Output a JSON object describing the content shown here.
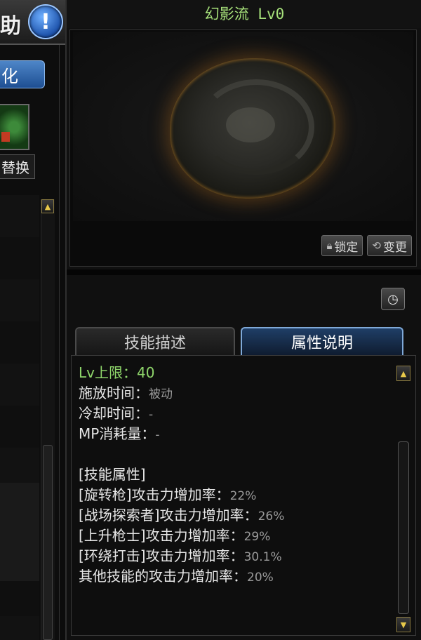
{
  "left_panel": {
    "title_char": "助",
    "help_icon": "!",
    "blue_tab_label": "化",
    "swap_label": "替换"
  },
  "skill": {
    "title": "幻影流 Lv0",
    "lock_label": "锁定",
    "change_label": "变更"
  },
  "tabs": {
    "description": "技能描述",
    "attributes": "属性说明"
  },
  "attributes": {
    "lv_limit_label": "Lv上限：",
    "lv_limit_value": "40",
    "cast_time_label": "施放时间：",
    "cast_time_value": "被动",
    "cooldown_label": "冷却时间：",
    "cooldown_value": "-",
    "mp_label": "MP消耗量：",
    "mp_value": "-",
    "section_header": "[技能属性]",
    "bonuses": [
      {
        "label": "[旋转枪]攻击力增加率：",
        "value": "22%"
      },
      {
        "label": "[战场探索者]攻击力增加率：",
        "value": "26%"
      },
      {
        "label": "[上升枪士]攻击力增加率：",
        "value": "29%"
      },
      {
        "label": "[环绕打击]攻击力增加率：",
        "value": "30.1%"
      },
      {
        "label": "其他技能的攻击力增加率：",
        "value": "20%"
      }
    ]
  },
  "colors": {
    "title_green": "#a6e07a",
    "active_tab": "#1f3e66",
    "scroll_gold": "#e8c94a"
  }
}
